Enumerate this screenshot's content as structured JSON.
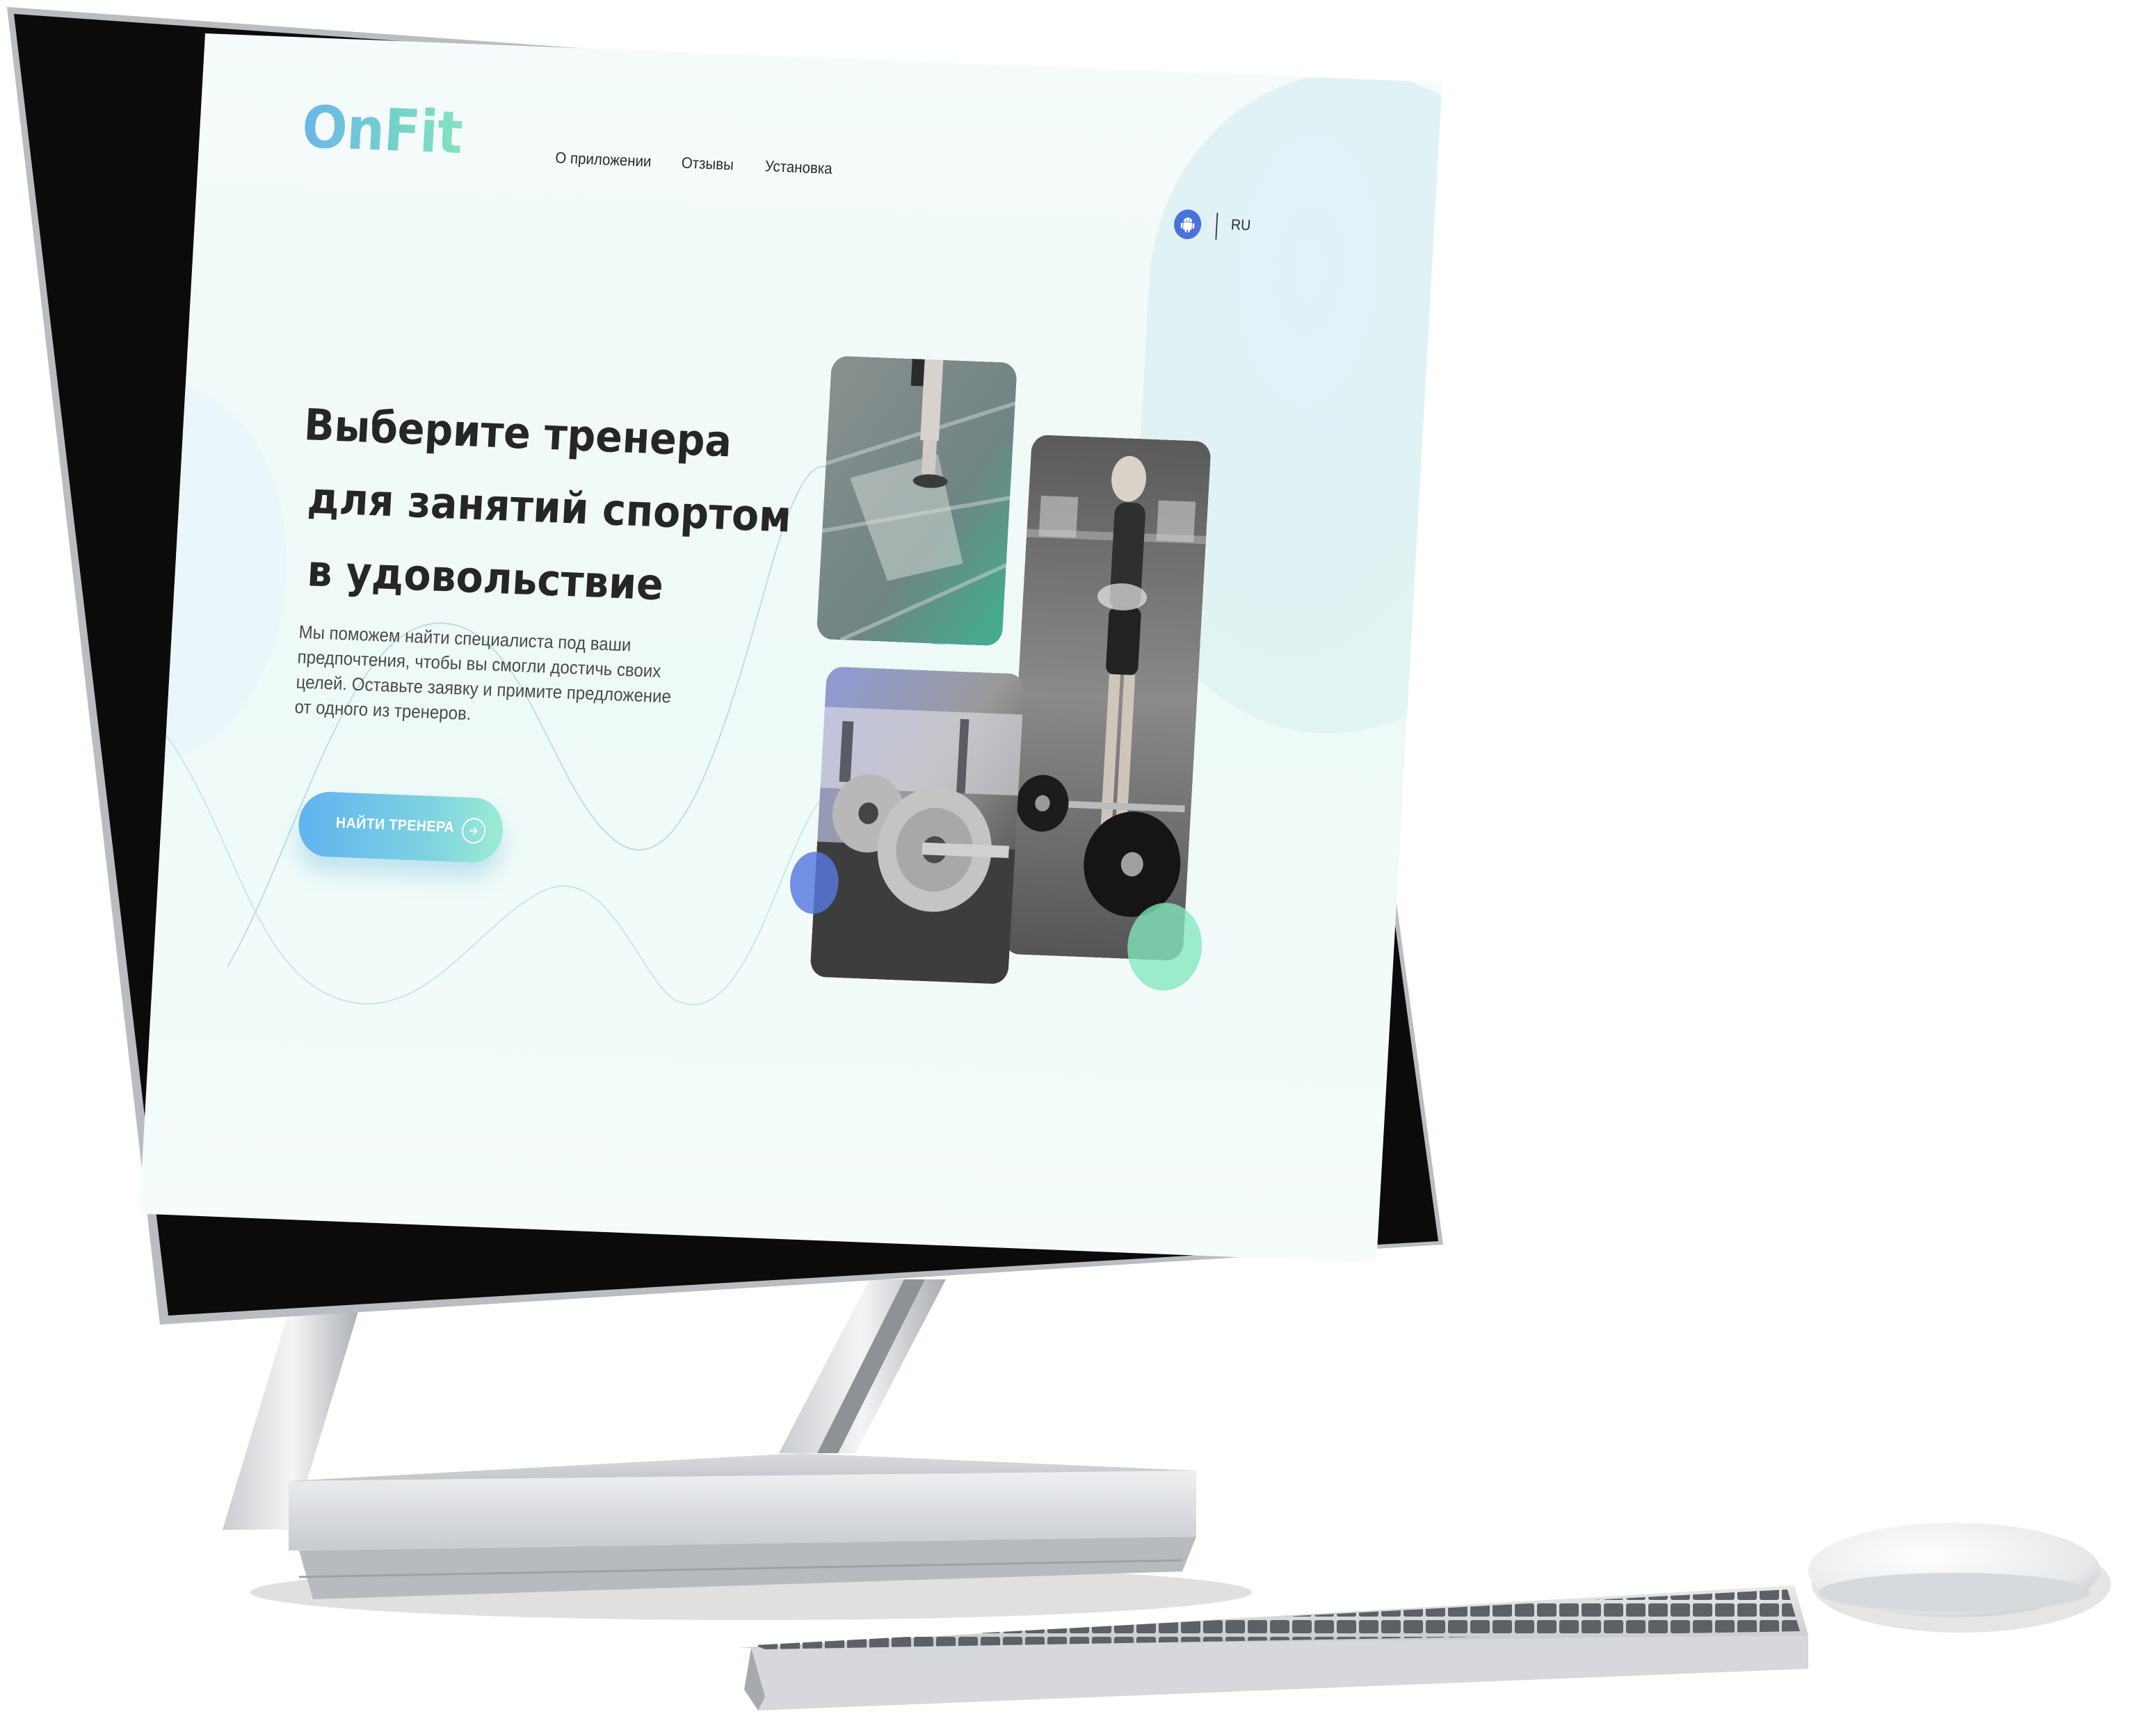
{
  "brand": {
    "logo_text": "OnFit",
    "colors": {
      "blue": "#6ab6ea",
      "mint": "#86e2c3",
      "accent": "#4b72d8"
    }
  },
  "nav": {
    "items": [
      {
        "label": "О приложении"
      },
      {
        "label": "Отзывы"
      },
      {
        "label": "Установка"
      }
    ]
  },
  "header": {
    "platform_icon": "android-icon",
    "language": "RU"
  },
  "hero": {
    "title_lines": [
      "Выберите тренера",
      "для занятий спортом",
      "в удовольствие"
    ],
    "description": "Мы поможем найти специалиста под ваши предпочтения, чтобы вы смогли достичь своих целей. Оставьте заявку и примите предложение от одного из тренеров.",
    "cta_label": "НАЙТИ ТРЕНЕРА",
    "cta_icon": "arrow-right-circle-icon"
  }
}
